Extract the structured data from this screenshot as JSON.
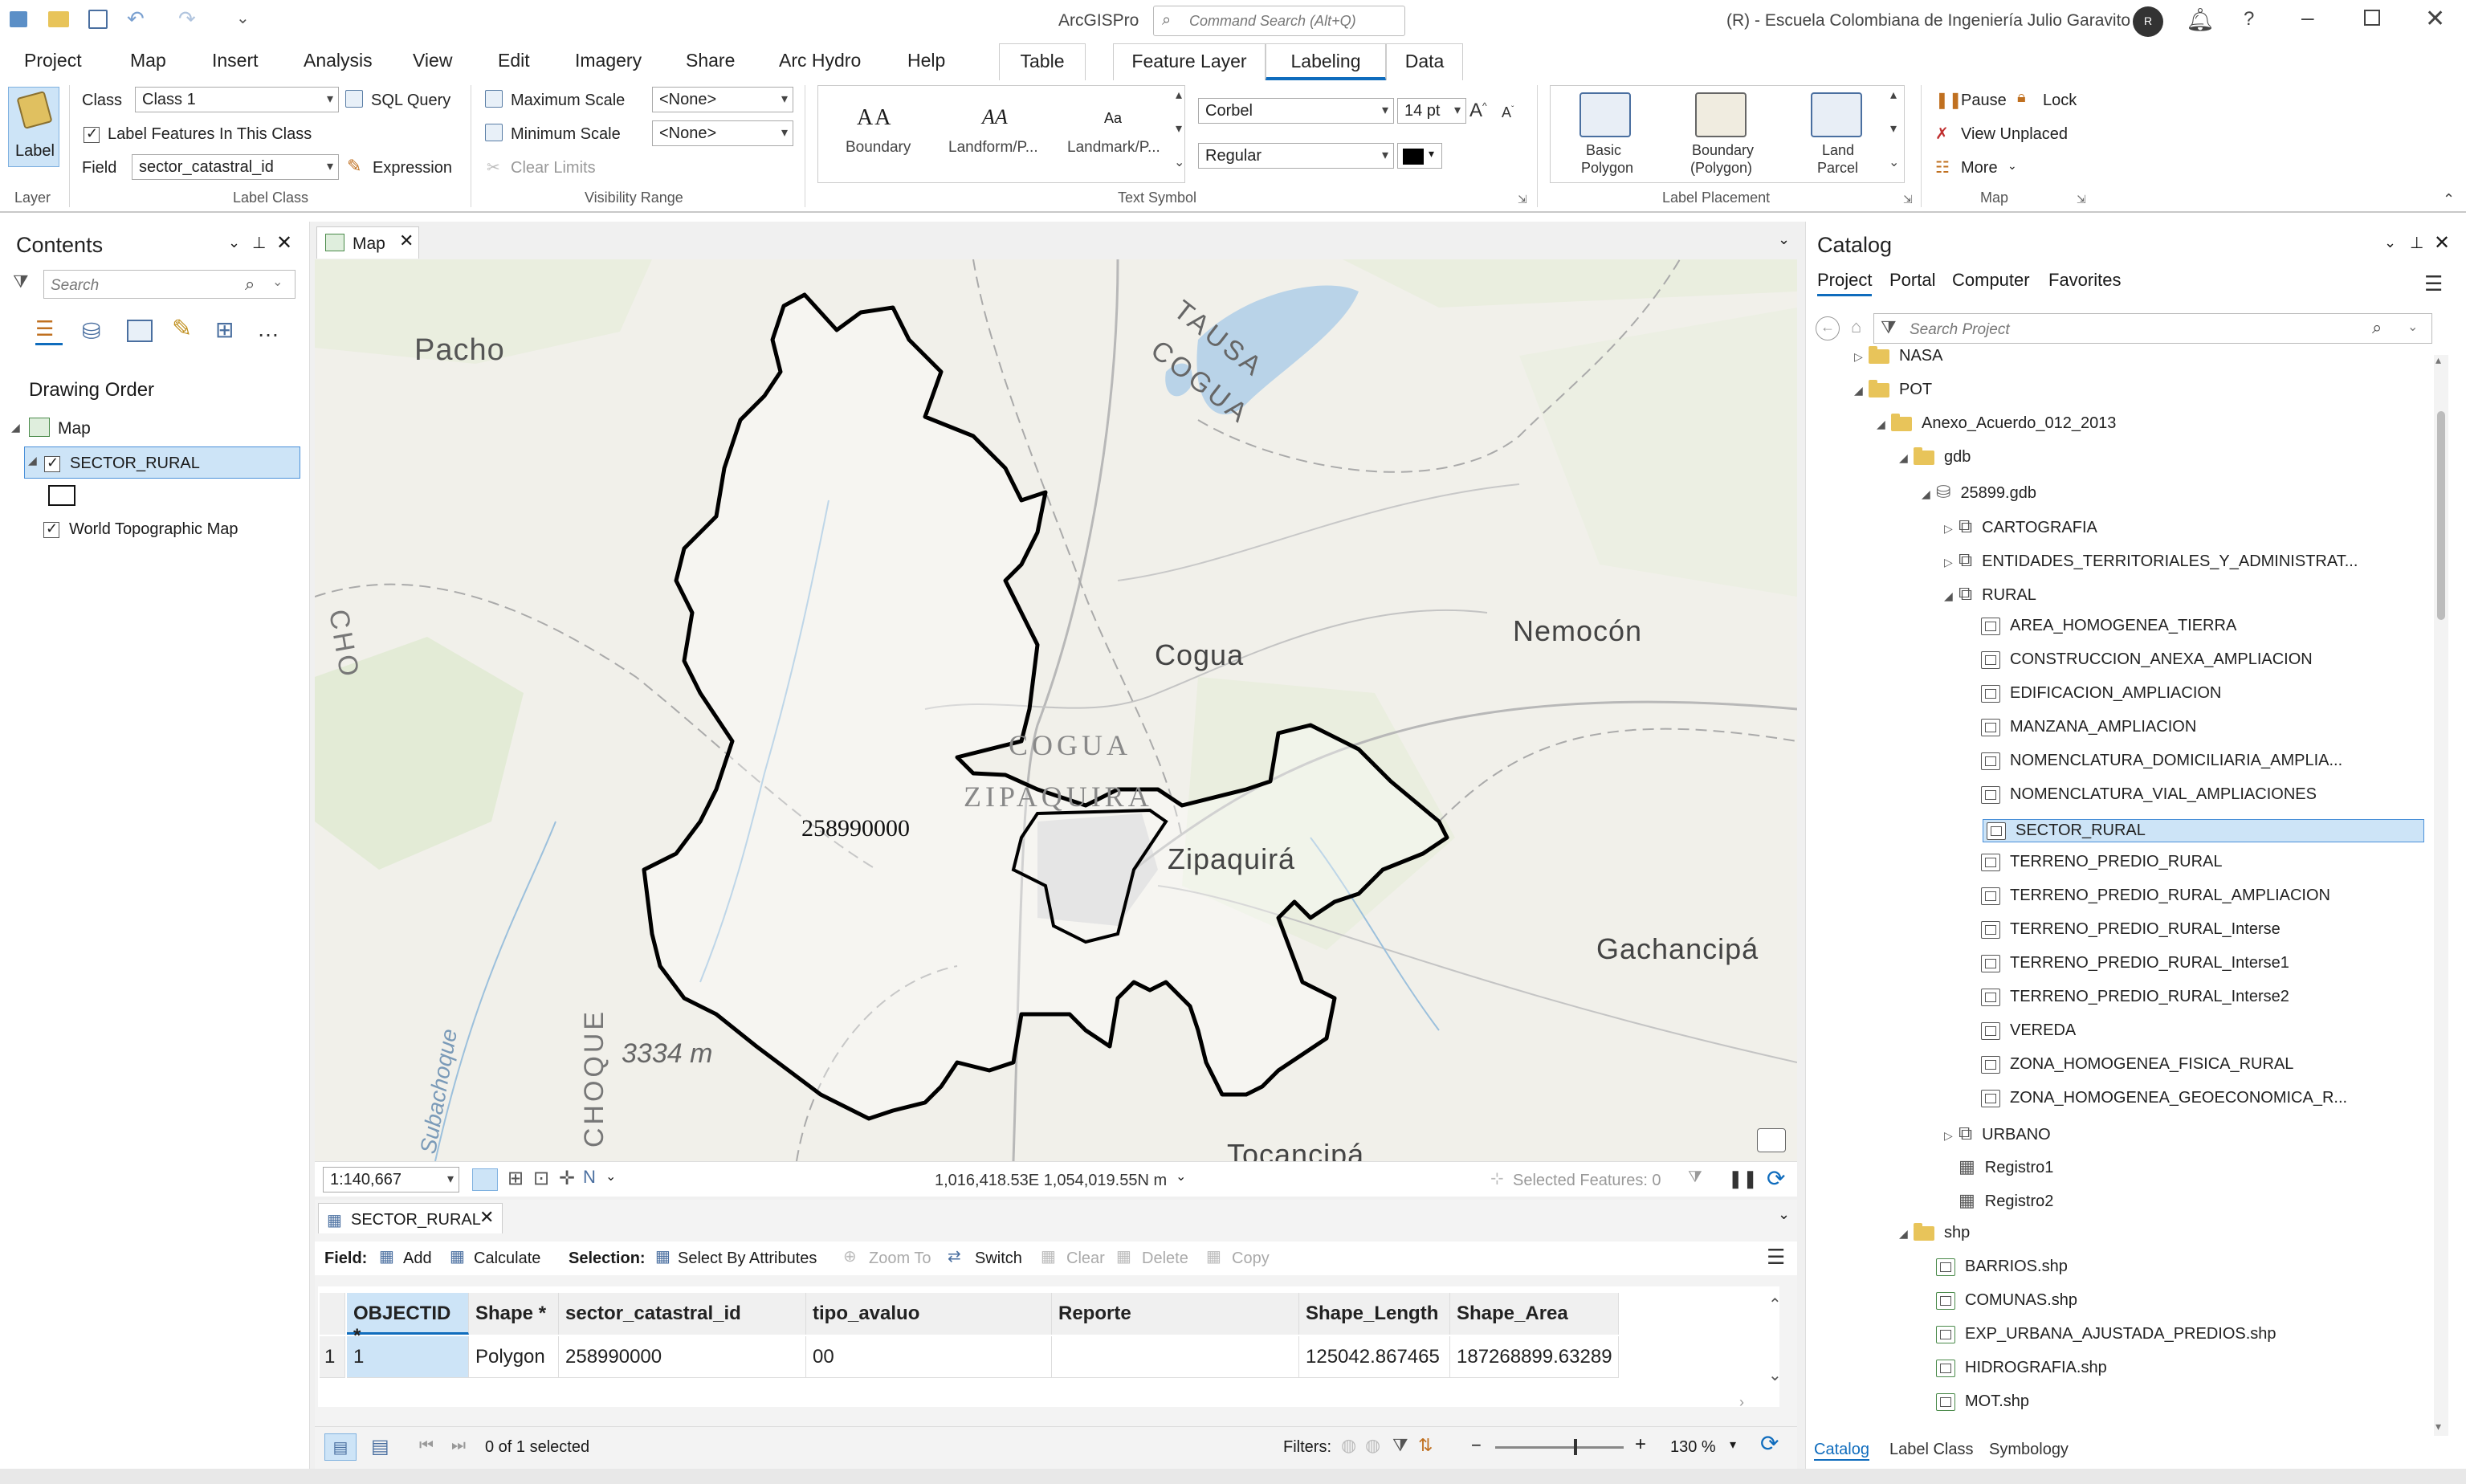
{
  "app": {
    "name": "ArcGISPro",
    "command_search_placeholder": "Command Search (Alt+Q)",
    "account": "(R) - Escuela Colombiana de Ingeniería Julio Garavito",
    "avatar_initial": "R"
  },
  "menu": {
    "items": [
      "Project",
      "Map",
      "Insert",
      "Analysis",
      "View",
      "Edit",
      "Imagery",
      "Share",
      "Arc Hydro",
      "Help"
    ],
    "context_tabs": [
      "Table",
      "Feature Layer",
      "Labeling",
      "Data"
    ],
    "active_tab": "Labeling"
  },
  "ribbon": {
    "layer_group": {
      "button": "Label",
      "group_label": "Layer"
    },
    "label_class": {
      "class_label": "Class",
      "class_value": "Class 1",
      "sql_query": "SQL Query",
      "label_features": "Label Features In This Class",
      "field_label": "Field",
      "field_value": "sector_catastral_id",
      "expression": "Expression",
      "group_label": "Label Class"
    },
    "visibility": {
      "max_scale": "Maximum Scale",
      "max_value": "<None>",
      "min_scale": "Minimum Scale",
      "min_value": "<None>",
      "clear_limits": "Clear Limits",
      "group_label": "Visibility Range"
    },
    "text_symbol": {
      "styles": [
        {
          "preview": "AA",
          "label": "Boundary"
        },
        {
          "preview": "AA",
          "label": "Landform/P..."
        },
        {
          "preview": "Aa",
          "label": "Landmark/P..."
        }
      ],
      "font": "Corbel",
      "size": "14 pt",
      "style": "Regular",
      "group_label": "Text Symbol",
      "font_color": "#000000"
    },
    "placement": {
      "items": [
        {
          "line1": "Basic",
          "line2": "Polygon"
        },
        {
          "line1": "Boundary",
          "line2": "(Polygon)"
        },
        {
          "line1": "Land",
          "line2": "Parcel"
        }
      ],
      "group_label": "Label Placement"
    },
    "map_group": {
      "pause": "Pause",
      "lock": "Lock",
      "view_unplaced": "View Unplaced",
      "more": "More",
      "group_label": "Map"
    }
  },
  "contents": {
    "title": "Contents",
    "search_placeholder": "Search",
    "drawing_order": "Drawing Order",
    "map_label": "Map",
    "layers": [
      {
        "name": "SECTOR_RURAL",
        "checked": true,
        "selected": true
      },
      {
        "name": "World Topographic Map",
        "checked": true,
        "selected": false
      }
    ]
  },
  "map": {
    "tab_label": "Map",
    "places": {
      "pacho": "Pacho",
      "cogua": "Cogua",
      "nemocon": "Nemocón",
      "zipaquira": "Zipaquirá",
      "gachancipa": "Gachancipá",
      "tausa": "TAUSA",
      "cogua2": "COGUA",
      "cogua_caps": "COGUA",
      "zipaquira_caps": "ZIPAQUIRA",
      "tocancipa": "Tocancipá",
      "elev": "3334 m",
      "subachoque": "Subachoque",
      "choque": "CHOQUE",
      "cho": "CHO"
    },
    "feature_label": "258990000",
    "scale": "1:140,667",
    "coordinates": "1,016,418.53E 1,054,019.55N m",
    "selected_features": "Selected Features: 0",
    "boundary_color": "#000000"
  },
  "attribute_table": {
    "tab_label": "SECTOR_RURAL",
    "toolbar": {
      "field_label": "Field:",
      "add": "Add",
      "calculate": "Calculate",
      "selection_label": "Selection:",
      "select_by_attributes": "Select By Attributes",
      "zoom_to": "Zoom To",
      "switch": "Switch",
      "clear": "Clear",
      "delete": "Delete",
      "copy": "Copy"
    },
    "columns": [
      "OBJECTID *",
      "Shape *",
      "sector_catastral_id",
      "tipo_avaluo",
      "Reporte",
      "Shape_Length",
      "Shape_Area"
    ],
    "rows": [
      {
        "row_num": "1",
        "cells": [
          "1",
          "Polygon",
          "258990000",
          "00",
          "",
          "125042.867465",
          "187268899.63289"
        ]
      }
    ],
    "status": "0 of 1 selected",
    "filters": "Filters:",
    "zoom": "130 %"
  },
  "catalog": {
    "title": "Catalog",
    "tabs": [
      "Project",
      "Portal",
      "Computer",
      "Favorites"
    ],
    "active_tab": "Project",
    "search_placeholder": "Search Project",
    "tree": [
      {
        "label": "NASA",
        "type": "folder",
        "level": 0,
        "expand": "▷"
      },
      {
        "label": "POT",
        "type": "folder",
        "level": 0,
        "expand": "◢"
      },
      {
        "label": "Anexo_Acuerdo_012_2013",
        "type": "folder",
        "level": 1,
        "expand": "◢"
      },
      {
        "label": "gdb",
        "type": "folder",
        "level": 2,
        "expand": "◢"
      },
      {
        "label": "25899.gdb",
        "type": "gdb",
        "level": 3,
        "expand": "◢"
      },
      {
        "label": "CARTOGRAFIA",
        "type": "dataset",
        "level": 4,
        "expand": "▷"
      },
      {
        "label": "ENTIDADES_TERRITORIALES_Y_ADMINISTRAT...",
        "type": "dataset",
        "level": 4,
        "expand": "▷"
      },
      {
        "label": "RURAL",
        "type": "dataset",
        "level": 4,
        "expand": "◢"
      },
      {
        "label": "AREA_HOMOGENEA_TIERRA",
        "type": "fc",
        "level": 5
      },
      {
        "label": "CONSTRUCCION_ANEXA_AMPLIACION",
        "type": "fc",
        "level": 5
      },
      {
        "label": "EDIFICACION_AMPLIACION",
        "type": "fc",
        "level": 5
      },
      {
        "label": "MANZANA_AMPLIACION",
        "type": "fc",
        "level": 5
      },
      {
        "label": "NOMENCLATURA_DOMICILIARIA_AMPLIA...",
        "type": "fcl",
        "level": 5
      },
      {
        "label": "NOMENCLATURA_VIAL_AMPLIACIONES",
        "type": "fcl",
        "level": 5
      },
      {
        "label": "SECTOR_RURAL",
        "type": "fc",
        "level": 5,
        "selected": true
      },
      {
        "label": "TERRENO_PREDIO_RURAL",
        "type": "fc",
        "level": 5
      },
      {
        "label": "TERRENO_PREDIO_RURAL_AMPLIACION",
        "type": "fc",
        "level": 5
      },
      {
        "label": "TERRENO_PREDIO_RURAL_Interse",
        "type": "fc",
        "level": 5
      },
      {
        "label": "TERRENO_PREDIO_RURAL_Interse1",
        "type": "fc",
        "level": 5
      },
      {
        "label": "TERRENO_PREDIO_RURAL_Interse2",
        "type": "fc",
        "level": 5
      },
      {
        "label": "VEREDA",
        "type": "fc",
        "level": 5
      },
      {
        "label": "ZONA_HOMOGENEA_FISICA_RURAL",
        "type": "fc",
        "level": 5
      },
      {
        "label": "ZONA_HOMOGENEA_GEOECONOMICA_R...",
        "type": "fc",
        "level": 5
      },
      {
        "label": "URBANO",
        "type": "dataset",
        "level": 4,
        "expand": "▷"
      },
      {
        "label": "Registro1",
        "type": "table",
        "level": 4
      },
      {
        "label": "Registro2",
        "type": "table",
        "level": 4
      },
      {
        "label": "shp",
        "type": "folder",
        "level": 2,
        "expand": "◢"
      },
      {
        "label": "BARRIOS.shp",
        "type": "shp",
        "level": 3
      },
      {
        "label": "COMUNAS.shp",
        "type": "shp",
        "level": 3
      },
      {
        "label": "EXP_URBANA_AJUSTADA_PREDIOS.shp",
        "type": "shp",
        "level": 3
      },
      {
        "label": "HIDROGRAFIA.shp",
        "type": "shpl",
        "level": 3
      },
      {
        "label": "MOT.shp",
        "type": "shp",
        "level": 3
      }
    ],
    "bottom_tabs": [
      "Catalog",
      "Label Class",
      "Symbology"
    ]
  },
  "colors": {
    "accent": "#0f6cbd",
    "selection": "#cde4f7",
    "selection_border": "#4a90d9"
  }
}
